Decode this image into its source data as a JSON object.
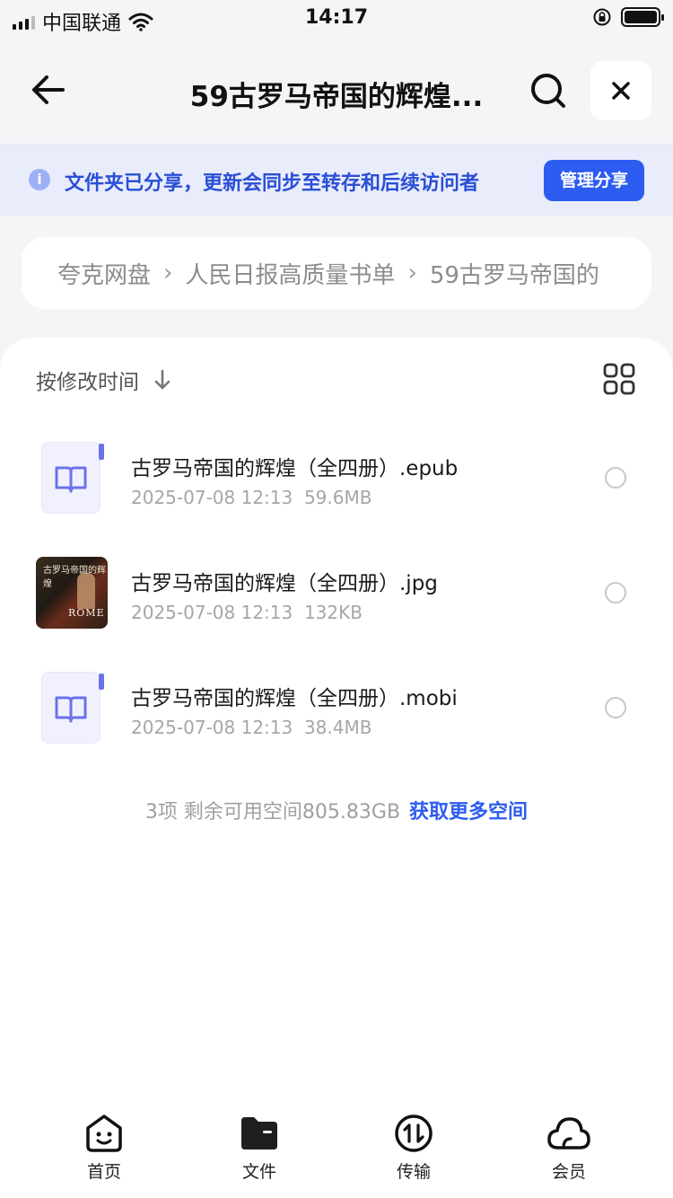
{
  "status_bar": {
    "carrier": "中国联通",
    "time": "14:17"
  },
  "header": {
    "title": "59古罗马帝国的辉煌...",
    "back_icon": "arrow-left-icon",
    "search_icon": "search-icon",
    "close_icon": "close-icon"
  },
  "notice": {
    "text": "文件夹已分享，更新会同步至转存和后续访问者",
    "button_label": "管理分享",
    "icon": "info-icon"
  },
  "breadcrumb": {
    "items": [
      "夸克网盘",
      "人民日报高质量书单",
      "59古罗马帝国的"
    ]
  },
  "sort": {
    "label": "按修改时间",
    "direction_icon": "arrow-down-icon",
    "view_icon": "grid-view-icon"
  },
  "files": [
    {
      "name": "古罗马帝国的辉煌（全四册）.epub",
      "date": "2025-07-08 12:13",
      "size": "59.6MB",
      "type": "ebook"
    },
    {
      "name": "古罗马帝国的辉煌（全四册）.jpg",
      "date": "2025-07-08 12:13",
      "size": "132KB",
      "type": "image",
      "thumb_title": "古罗马帝国的辉煌",
      "thumb_caption": "ROME"
    },
    {
      "name": "古罗马帝国的辉煌（全四册）.mobi",
      "date": "2025-07-08 12:13",
      "size": "38.4MB",
      "type": "ebook"
    }
  ],
  "footer": {
    "summary": "3项 剩余可用空间805.83GB",
    "link": "获取更多空间"
  },
  "tabbar": {
    "items": [
      {
        "label": "首页",
        "icon": "home-face-icon"
      },
      {
        "label": "文件",
        "icon": "folder-icon"
      },
      {
        "label": "传输",
        "icon": "transfer-icon"
      },
      {
        "label": "会员",
        "icon": "cloud-icon"
      }
    ]
  },
  "colors": {
    "accent": "#2d5cf0",
    "notice_bg": "#e9ecfb",
    "notice_text": "#2a4fd6"
  }
}
